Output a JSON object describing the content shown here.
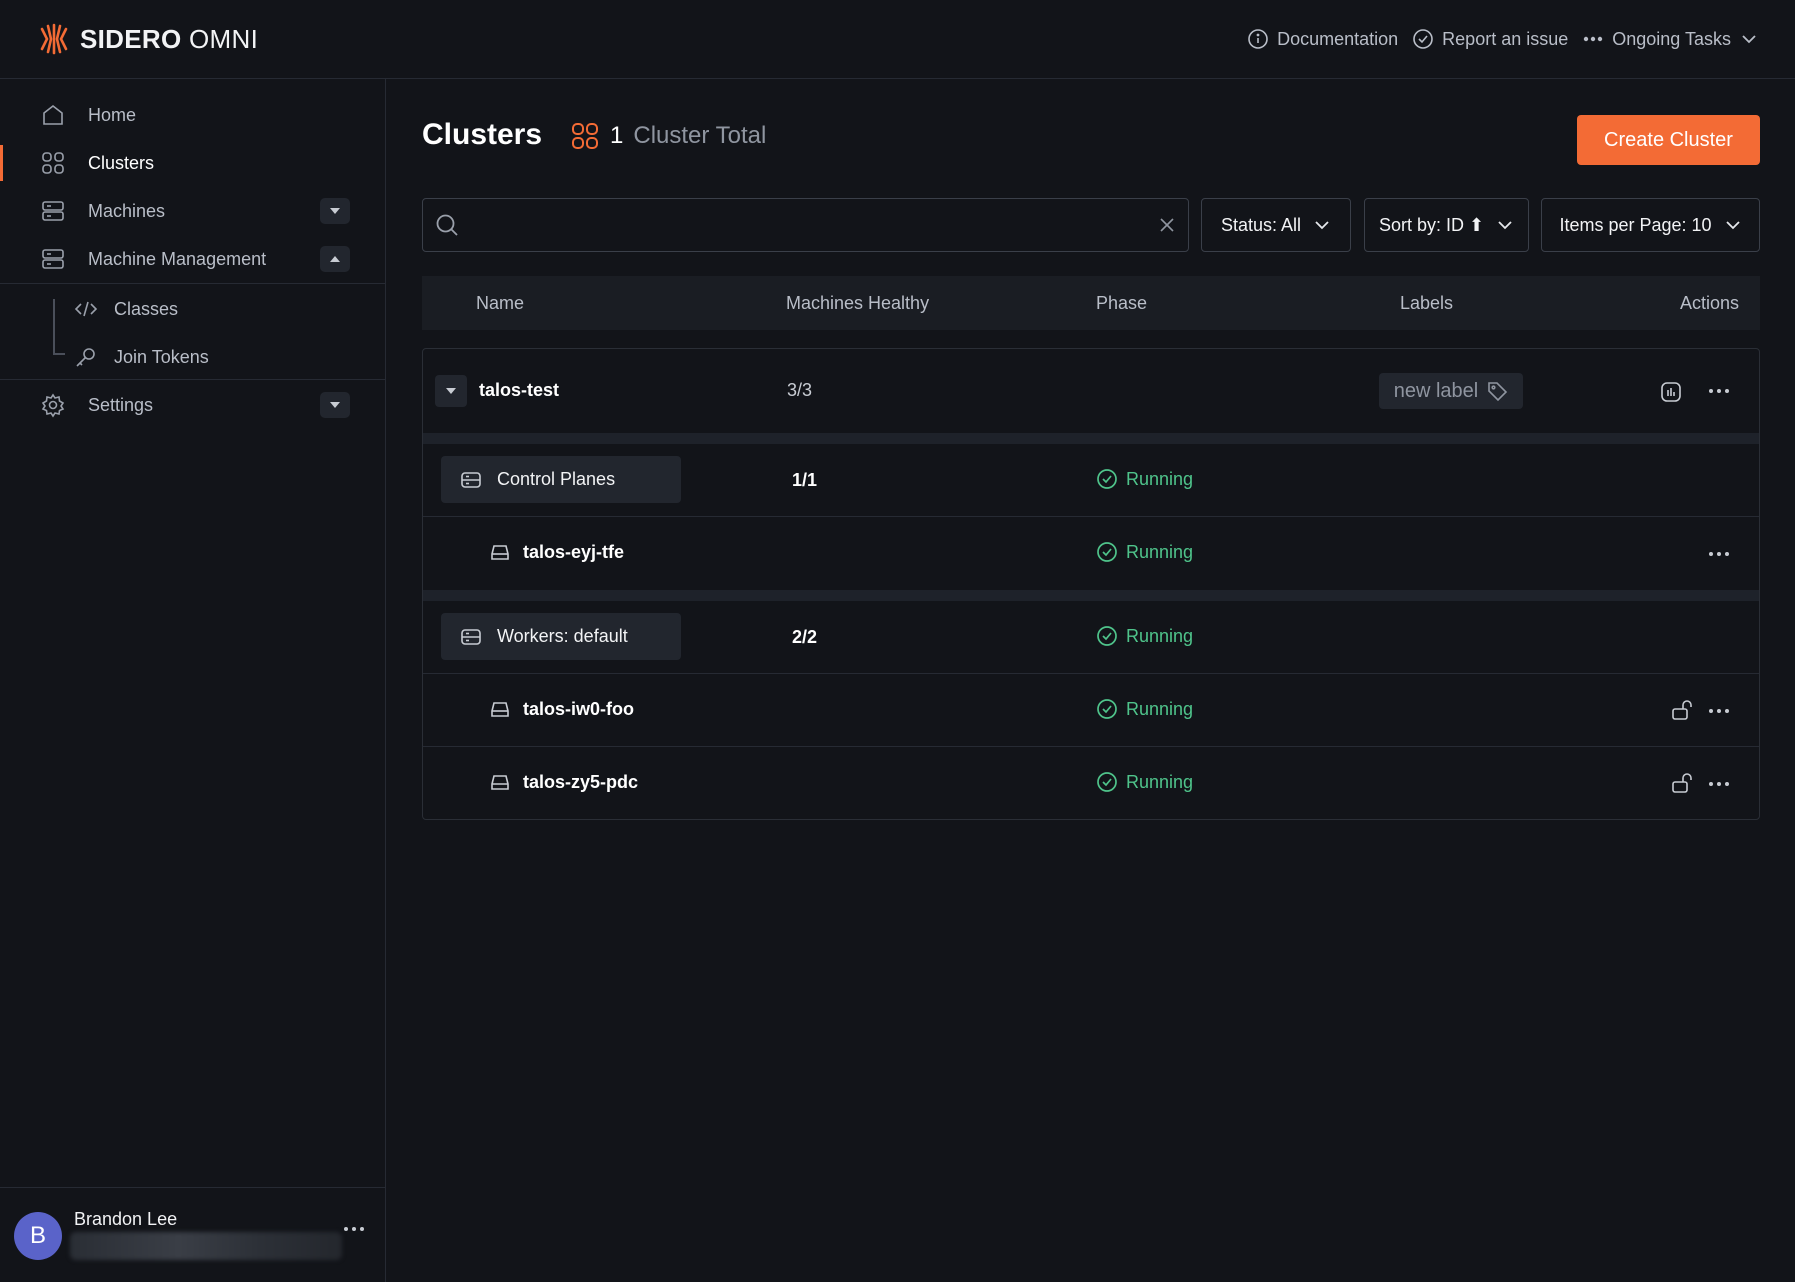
{
  "brand": {
    "name_bold": "SIDERO",
    "name_light": "OMNI"
  },
  "topbar": {
    "documentation": "Documentation",
    "report_issue": "Report an issue",
    "ongoing_tasks": "Ongoing Tasks"
  },
  "sidebar": {
    "home": "Home",
    "clusters": "Clusters",
    "machines": "Machines",
    "machine_management": "Machine Management",
    "classes": "Classes",
    "join_tokens": "Join Tokens",
    "settings": "Settings"
  },
  "user": {
    "initial": "B",
    "name": "Brandon Lee"
  },
  "main": {
    "title": "Clusters",
    "total_count": "1",
    "total_label": "Cluster Total",
    "create_button": "Create Cluster",
    "search_placeholder": "",
    "filters": {
      "status": "Status: All",
      "sort": "Sort by: ID ⬆",
      "per_page": "Items per Page: 10"
    },
    "columns": {
      "name": "Name",
      "machines_healthy": "Machines Healthy",
      "phase": "Phase",
      "labels": "Labels",
      "actions": "Actions"
    },
    "cluster": {
      "name": "talos-test",
      "healthy": "3/3",
      "new_label": "new label"
    },
    "groups": [
      {
        "name": "Control Planes",
        "healthy": "1/1",
        "phase": "Running",
        "machines": [
          {
            "name": "talos-eyj-tfe",
            "phase": "Running"
          }
        ]
      },
      {
        "name": "Workers: default",
        "healthy": "2/2",
        "phase": "Running",
        "machines": [
          {
            "name": "talos-iw0-foo",
            "phase": "Running"
          },
          {
            "name": "talos-zy5-pdc",
            "phase": "Running"
          }
        ]
      }
    ]
  },
  "colors": {
    "accent": "#f36b35",
    "success": "#4fc48b",
    "background": "#121419"
  }
}
